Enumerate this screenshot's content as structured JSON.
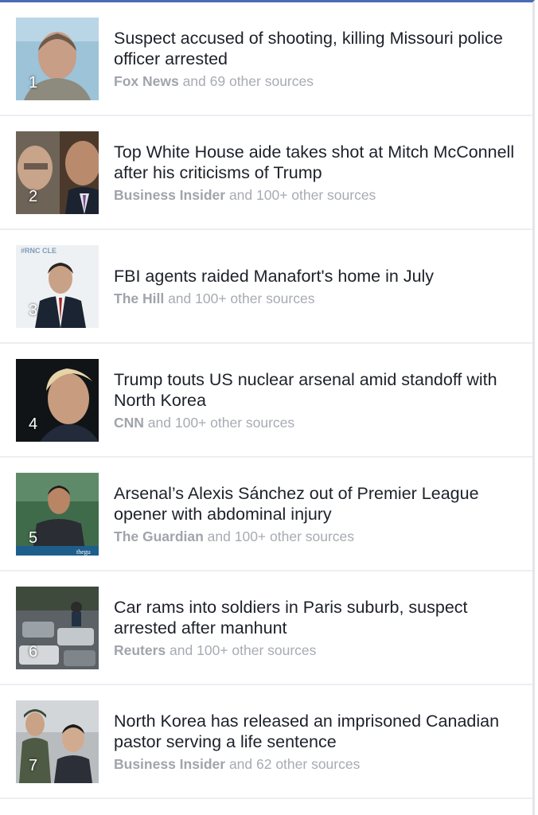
{
  "items": [
    {
      "rank": "1",
      "headline": "Suspect accused of shooting, killing Missouri police officer arrested",
      "source": "Fox News",
      "others": "and 69 other sources"
    },
    {
      "rank": "2",
      "headline": "Top White House aide takes shot at Mitch McConnell after his criticisms of Trump",
      "source": "Business Insider",
      "others": "and 100+ other sources"
    },
    {
      "rank": "3",
      "headline": "FBI agents raided Manafort's home in July",
      "source": "The Hill",
      "others": "and 100+ other sources"
    },
    {
      "rank": "4",
      "headline": "Trump touts US nuclear arsenal amid standoff with North Korea",
      "source": "CNN",
      "others": "and 100+ other sources"
    },
    {
      "rank": "5",
      "headline": "Arsenal’s Alexis Sánchez out of Premier League opener with abdominal injury",
      "source": "The Guardian",
      "others": "and 100+ other sources"
    },
    {
      "rank": "6",
      "headline": "Car rams into soldiers in Paris suburb, suspect arrested after manhunt",
      "source": "Reuters",
      "others": "and 100+ other sources"
    },
    {
      "rank": "7",
      "headline": "North Korea has released an imprisoned Canadian pastor serving a life sentence",
      "source": "Business Insider",
      "others": "and 62 other sources"
    }
  ],
  "thumb_watermarks": {
    "item3": "#RNC CLE",
    "item5": "thegu"
  },
  "colors": {
    "accent_top": "#4a6bb5",
    "headline": "#1d2129",
    "meta": "#a7abb2"
  }
}
